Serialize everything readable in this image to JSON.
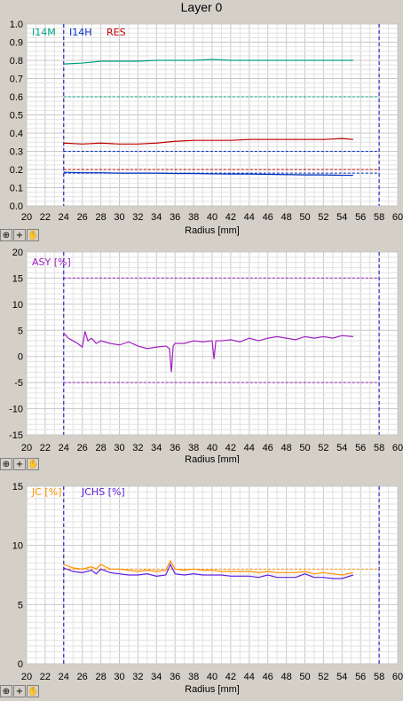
{
  "title": "Layer 0",
  "toolbar": {
    "zoom_icon": "zoom-icon",
    "crosshair_icon": "crosshair-icon",
    "pan_icon": "hand-pan-icon",
    "crosshair_glyph": "+"
  },
  "chart_data": [
    {
      "type": "line",
      "xlabel": "Radius [mm]",
      "xlim": [
        20,
        60
      ],
      "ylim": [
        0,
        1.0
      ],
      "yticks": [
        "0.0",
        "0.1",
        "0.2",
        "0.3",
        "0.4",
        "0.5",
        "0.6",
        "0.7",
        "0.8",
        "0.9",
        "1.0"
      ],
      "xticks": [
        "20",
        "22",
        "24",
        "26",
        "28",
        "30",
        "32",
        "34",
        "36",
        "38",
        "40",
        "42",
        "44",
        "46",
        "48",
        "50",
        "52",
        "54",
        "56",
        "58",
        "60"
      ],
      "grid": true,
      "legend_placement": "top-left",
      "series": [
        {
          "name": "I14M",
          "color": "#00a080",
          "x": [
            24,
            26,
            28,
            30,
            32,
            34,
            36,
            38,
            40,
            42,
            44,
            46,
            48,
            50,
            52,
            54,
            55.2
          ],
          "y": [
            0.78,
            0.785,
            0.795,
            0.795,
            0.795,
            0.8,
            0.8,
            0.8,
            0.805,
            0.8,
            0.8,
            0.8,
            0.8,
            0.8,
            0.8,
            0.8,
            0.8
          ]
        },
        {
          "name": "I14H",
          "color": "#0030c0",
          "x": [
            24,
            26,
            28,
            30,
            32,
            34,
            36,
            38,
            40,
            42,
            44,
            46,
            48,
            50,
            52,
            54,
            55.2
          ],
          "y": [
            0.185,
            0.182,
            0.182,
            0.18,
            0.18,
            0.18,
            0.178,
            0.178,
            0.176,
            0.175,
            0.175,
            0.173,
            0.172,
            0.17,
            0.17,
            0.168,
            0.168
          ]
        },
        {
          "name": "RES",
          "color": "#c00000",
          "x": [
            24,
            26,
            28,
            30,
            32,
            34,
            36,
            38,
            40,
            42,
            44,
            46,
            48,
            50,
            52,
            54,
            55.2
          ],
          "y": [
            0.345,
            0.34,
            0.345,
            0.34,
            0.34,
            0.345,
            0.355,
            0.36,
            0.36,
            0.36,
            0.365,
            0.365,
            0.365,
            0.365,
            0.365,
            0.37,
            0.365
          ]
        }
      ],
      "reference_lines": [
        {
          "color": "#00a080",
          "y": 0.6,
          "x": [
            24,
            58
          ]
        },
        {
          "color": "#0030c0",
          "y": 0.3,
          "x": [
            24,
            58
          ]
        },
        {
          "color": "#c00000",
          "y": 0.2,
          "x": [
            24,
            58
          ]
        },
        {
          "color": "#0030c0",
          "y": 0.18,
          "x": [
            24,
            58
          ]
        }
      ],
      "vertical_lines": [
        {
          "color": "#0000c0",
          "x": 24
        },
        {
          "color": "#0000c0",
          "x": 58
        }
      ]
    },
    {
      "type": "line",
      "xlabel": "Radius [mm]",
      "xlim": [
        20,
        60
      ],
      "ylim": [
        -15,
        20
      ],
      "yticks": [
        "-15",
        "-10",
        "-5",
        "0",
        "5",
        "10",
        "15",
        "20"
      ],
      "xticks": [
        "20",
        "22",
        "24",
        "26",
        "28",
        "30",
        "32",
        "34",
        "36",
        "38",
        "40",
        "42",
        "44",
        "46",
        "48",
        "50",
        "52",
        "54",
        "56",
        "58",
        "60"
      ],
      "grid": true,
      "legend_placement": "top-left",
      "series": [
        {
          "name": "ASY [%]",
          "color": "#a020c0",
          "x": [
            24,
            24.5,
            25,
            25.5,
            26,
            26.3,
            26.6,
            27,
            27.5,
            28,
            29,
            30,
            31,
            32,
            33,
            34,
            35,
            35.4,
            35.6,
            35.8,
            36,
            37,
            38,
            39,
            40,
            40.2,
            40.4,
            41,
            42,
            43,
            44,
            45,
            46,
            47,
            48,
            49,
            50,
            51,
            52,
            53,
            54,
            55.2
          ],
          "y": [
            4.5,
            3.5,
            3.0,
            2.5,
            1.8,
            4.8,
            3.0,
            3.5,
            2.5,
            3.0,
            2.5,
            2.2,
            2.8,
            2.0,
            1.5,
            1.8,
            2.0,
            1.5,
            -3.0,
            2.0,
            2.5,
            2.5,
            3.0,
            2.8,
            3.0,
            -0.5,
            3.0,
            3.0,
            3.2,
            2.8,
            3.5,
            3.0,
            3.5,
            3.8,
            3.5,
            3.2,
            3.8,
            3.5,
            3.8,
            3.5,
            4.0,
            3.8
          ]
        }
      ],
      "reference_lines": [
        {
          "color": "#a020c0",
          "y": 15,
          "x": [
            24,
            58
          ]
        },
        {
          "color": "#a020c0",
          "y": -5,
          "x": [
            24,
            58
          ]
        }
      ],
      "vertical_lines": [
        {
          "color": "#0000c0",
          "x": 24
        },
        {
          "color": "#0000c0",
          "x": 58
        }
      ]
    },
    {
      "type": "line",
      "xlabel": "Radius [mm]",
      "xlim": [
        20,
        60
      ],
      "ylim": [
        0,
        15
      ],
      "yticks": [
        "0",
        "5",
        "10",
        "15"
      ],
      "xticks": [
        "20",
        "22",
        "24",
        "26",
        "28",
        "30",
        "32",
        "34",
        "36",
        "38",
        "40",
        "42",
        "44",
        "46",
        "48",
        "50",
        "52",
        "54",
        "56",
        "58",
        "60"
      ],
      "grid": true,
      "legend_placement": "top-left",
      "series": [
        {
          "name": "JC [%]",
          "color": "#ff9000",
          "x": [
            24,
            25,
            26,
            27,
            27.5,
            28,
            29,
            30,
            31,
            32,
            33,
            34,
            35,
            35.5,
            36,
            37,
            38,
            39,
            40,
            41,
            42,
            43,
            44,
            45,
            46,
            47,
            48,
            49,
            50,
            51,
            52,
            53,
            54,
            55.2
          ],
          "y": [
            8.4,
            8.1,
            8.0,
            8.2,
            8.0,
            8.4,
            8.0,
            8.0,
            7.9,
            7.8,
            7.9,
            7.8,
            7.9,
            8.7,
            8.0,
            7.9,
            8.0,
            7.9,
            7.9,
            7.8,
            7.8,
            7.8,
            7.8,
            7.7,
            7.8,
            7.7,
            7.7,
            7.7,
            7.8,
            7.6,
            7.7,
            7.6,
            7.5,
            7.7
          ]
        },
        {
          "name": "JCHS [%]",
          "color": "#6020e0",
          "x": [
            24,
            25,
            26,
            27,
            27.5,
            28,
            29,
            30,
            31,
            32,
            33,
            34,
            35,
            35.5,
            36,
            37,
            38,
            39,
            40,
            41,
            42,
            43,
            44,
            45,
            46,
            47,
            48,
            49,
            50,
            51,
            52,
            53,
            54,
            55.2
          ],
          "y": [
            8.1,
            7.8,
            7.7,
            7.9,
            7.6,
            8.0,
            7.7,
            7.6,
            7.5,
            7.5,
            7.6,
            7.4,
            7.5,
            8.4,
            7.6,
            7.5,
            7.6,
            7.5,
            7.5,
            7.5,
            7.4,
            7.4,
            7.4,
            7.3,
            7.5,
            7.3,
            7.3,
            7.3,
            7.6,
            7.3,
            7.3,
            7.2,
            7.2,
            7.5
          ]
        }
      ],
      "reference_lines": [
        {
          "color": "#ff9000",
          "y": 8,
          "x": [
            24,
            58
          ]
        }
      ],
      "vertical_lines": [
        {
          "color": "#0000c0",
          "x": 24
        },
        {
          "color": "#0000c0",
          "x": 58
        }
      ]
    }
  ]
}
